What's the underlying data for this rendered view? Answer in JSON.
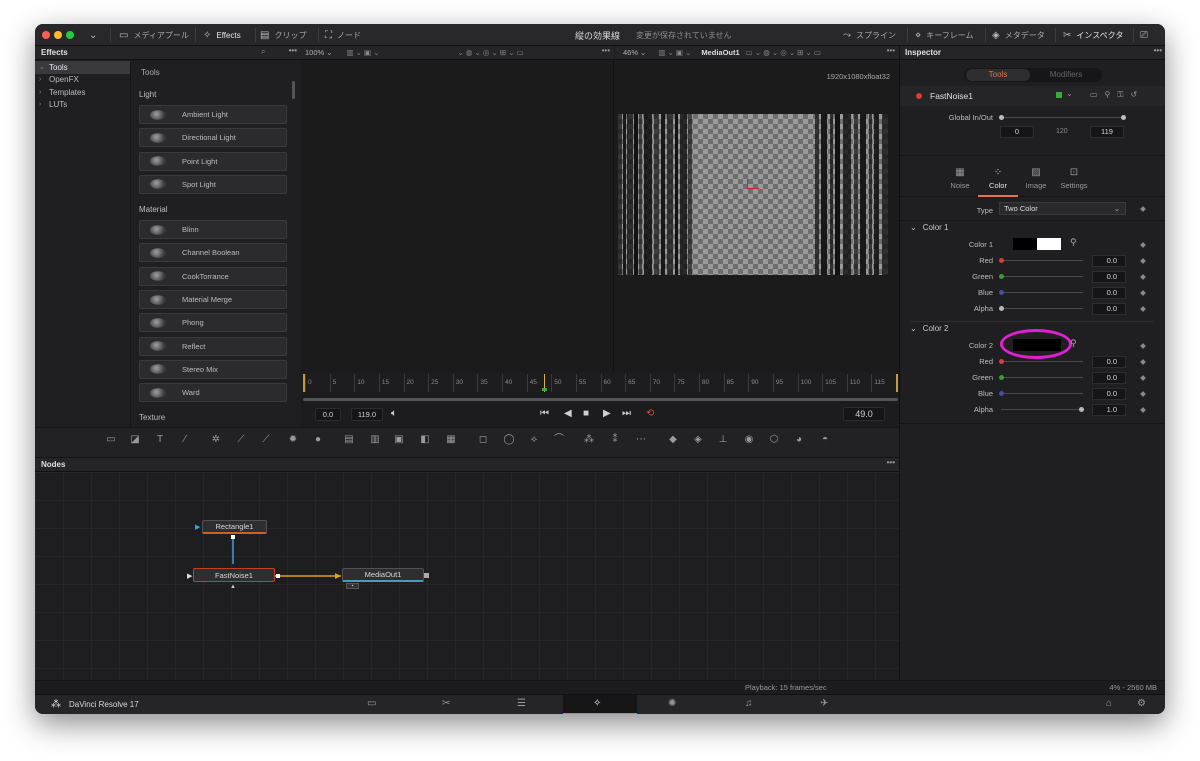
{
  "titlebar": {
    "media_pool": "メディアプール",
    "effects": "Effects",
    "clips": "クリップ",
    "nodes": "ノード",
    "title": "縦の効果線",
    "unsaved": "変更が保存されていません",
    "spline": "スプライン",
    "keyframes": "キーフレーム",
    "metadata": "メタデータ",
    "inspector": "インスペクタ"
  },
  "effects": {
    "header": "Effects",
    "tree": [
      "Tools",
      "OpenFX",
      "Templates",
      "LUTs"
    ],
    "tools_title": "Tools",
    "categories": [
      {
        "name": "Light",
        "items": [
          "Ambient Light",
          "Directional Light",
          "Point Light",
          "Spot Light"
        ]
      },
      {
        "name": "Material",
        "items": [
          "Blinn",
          "Channel Boolean",
          "CookTorrance",
          "Material Merge",
          "Phong",
          "Reflect",
          "Stereo Mix",
          "Ward"
        ]
      },
      {
        "name": "Texture",
        "items": []
      }
    ]
  },
  "viewer_left": {
    "zoom": "100%"
  },
  "viewer_right": {
    "zoom": "46%",
    "name": "MediaOut1",
    "resolution": "1920x1080xfloat32"
  },
  "timeline": {
    "ticks": [
      "0",
      "5",
      "10",
      "15",
      "20",
      "25",
      "30",
      "35",
      "40",
      "45",
      "50",
      "55",
      "60",
      "65",
      "70",
      "75",
      "80",
      "85",
      "90",
      "95",
      "100",
      "105",
      "110",
      "115"
    ],
    "start": "0.0",
    "end": "119.0",
    "current": "49.0",
    "playhead_frame": 48.5,
    "total_frames": 120
  },
  "nodes": {
    "header": "Nodes",
    "items": [
      "Rectangle1",
      "FastNoise1",
      "MediaOut1"
    ]
  },
  "inspector": {
    "header": "Inspector",
    "tab_tools": "Tools",
    "tab_modifiers": "Modifiers",
    "tool_name": "FastNoise1",
    "global_label": "Global In/Out",
    "global_in": "0",
    "global_mid": "120",
    "global_out": "119",
    "subtabs": [
      "Noise",
      "Color",
      "Image",
      "Settings"
    ],
    "active_subtab": "Color",
    "type_label": "Type",
    "type_value": "Two Color",
    "color1": {
      "title": "Color 1",
      "label": "Color 1",
      "channels": [
        {
          "label": "Red",
          "value": "0.0",
          "color": "#e03a3a"
        },
        {
          "label": "Green",
          "value": "0.0",
          "color": "#3a9a3a"
        },
        {
          "label": "Blue",
          "value": "0.0",
          "color": "#4a4aa8"
        },
        {
          "label": "Alpha",
          "value": "0.0",
          "color": "#b8b8b8"
        }
      ]
    },
    "color2": {
      "title": "Color 2",
      "label": "Color 2",
      "channels": [
        {
          "label": "Red",
          "value": "0.0",
          "color": "#e03a3a"
        },
        {
          "label": "Green",
          "value": "0.0",
          "color": "#3a9a3a"
        },
        {
          "label": "Blue",
          "value": "0.0",
          "color": "#4a4aa8"
        },
        {
          "label": "Alpha",
          "value": "1.0",
          "color": "#b8b8b8"
        }
      ]
    }
  },
  "status": {
    "playback": "Playback: 15 frames/sec",
    "memory": "4% - 2560 MB"
  },
  "bottombar": {
    "app_name": "DaVinci Resolve 17"
  },
  "colors": {
    "accent": "#e8734a",
    "annotation": "#e020d0",
    "timeline_marker": "#c69b3a"
  }
}
